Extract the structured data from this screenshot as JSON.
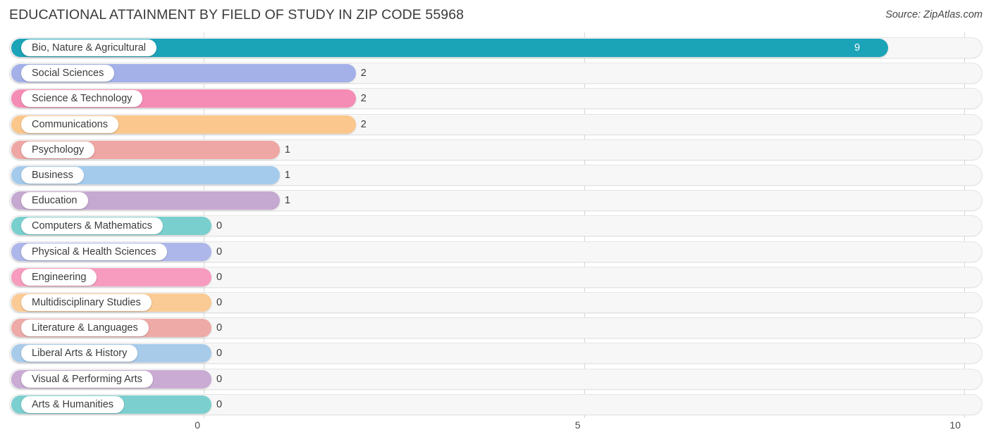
{
  "header": {
    "title": "EDUCATIONAL ATTAINMENT BY FIELD OF STUDY IN ZIP CODE 55968",
    "source": "Source: ZipAtlas.com"
  },
  "chart_data": {
    "type": "bar",
    "orientation": "horizontal",
    "title": "EDUCATIONAL ATTAINMENT BY FIELD OF STUDY IN ZIP CODE 55968",
    "xlabel": "",
    "ylabel": "",
    "xlim": [
      0,
      10
    ],
    "xticks": [
      0,
      5,
      10
    ],
    "xtick_labels": [
      "0",
      "5",
      "10"
    ],
    "grid": true,
    "legend": false,
    "categories": [
      "Bio, Nature & Agricultural",
      "Social Sciences",
      "Science & Technology",
      "Communications",
      "Psychology",
      "Business",
      "Education",
      "Computers & Mathematics",
      "Physical & Health Sciences",
      "Engineering",
      "Multidisciplinary Studies",
      "Literature & Languages",
      "Liberal Arts & History",
      "Visual & Performing Arts",
      "Arts & Humanities"
    ],
    "values": [
      9,
      2,
      2,
      2,
      1,
      1,
      1,
      0,
      0,
      0,
      0,
      0,
      0,
      0,
      0
    ],
    "value_labels": [
      "9",
      "2",
      "2",
      "2",
      "1",
      "1",
      "1",
      "0",
      "0",
      "0",
      "0",
      "0",
      "0",
      "0",
      "0"
    ],
    "colors": [
      "#1ba3b8",
      "#a4b0e8",
      "#f58cb5",
      "#fbc78d",
      "#eea7a4",
      "#a4cbec",
      "#c6a9d0",
      "#79cfcd",
      "#adb7ea",
      "#f79cbf",
      "#fbcb96",
      "#eeaaa7",
      "#a8cbea",
      "#c9abd3",
      "#7ccfcf"
    ]
  },
  "rows": [
    {
      "label": "Bio, Nature & Agricultural",
      "value": "9",
      "color": "#1ba3b8",
      "inside": true
    },
    {
      "label": "Social Sciences",
      "value": "2",
      "color": "#a4b0e8",
      "inside": false
    },
    {
      "label": "Science & Technology",
      "value": "2",
      "color": "#f58cb5",
      "inside": false
    },
    {
      "label": "Communications",
      "value": "2",
      "color": "#fbc78d",
      "inside": false
    },
    {
      "label": "Psychology",
      "value": "1",
      "color": "#eea7a4",
      "inside": false
    },
    {
      "label": "Business",
      "value": "1",
      "color": "#a4cbec",
      "inside": false
    },
    {
      "label": "Education",
      "value": "1",
      "color": "#c6a9d0",
      "inside": false
    },
    {
      "label": "Computers & Mathematics",
      "value": "0",
      "color": "#79cfcd",
      "inside": false
    },
    {
      "label": "Physical & Health Sciences",
      "value": "0",
      "color": "#adb7ea",
      "inside": false
    },
    {
      "label": "Engineering",
      "value": "0",
      "color": "#f79cbf",
      "inside": false
    },
    {
      "label": "Multidisciplinary Studies",
      "value": "0",
      "color": "#fbcb96",
      "inside": false
    },
    {
      "label": "Literature & Languages",
      "value": "0",
      "color": "#eeaaa7",
      "inside": false
    },
    {
      "label": "Liberal Arts & History",
      "value": "0",
      "color": "#a8cbea",
      "inside": false
    },
    {
      "label": "Visual & Performing Arts",
      "value": "0",
      "color": "#c9abd3",
      "inside": false
    },
    {
      "label": "Arts & Humanities",
      "value": "0",
      "color": "#7ccfcf",
      "inside": false
    }
  ]
}
